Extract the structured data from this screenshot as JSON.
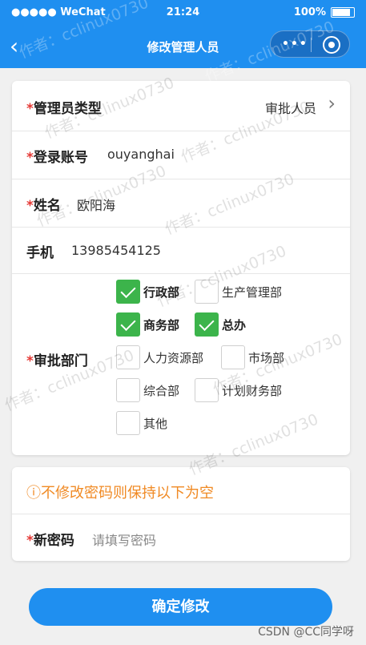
{
  "status_bar": {
    "carrier": "●●●●● WeChat",
    "time": "21:24",
    "battery": "100%"
  },
  "nav": {
    "back_icon": "chevron-left-icon",
    "title": "修改管理人员",
    "menu_icon": "more-dots-icon",
    "target_icon": "target-icon"
  },
  "form": {
    "admin_type": {
      "required": "*",
      "label": "管理员类型",
      "value": "审批人员"
    },
    "login": {
      "required": "*",
      "label": "登录账号",
      "value": "ouyanghai"
    },
    "name": {
      "required": "*",
      "label": "姓名",
      "value": "欧阳海"
    },
    "phone": {
      "label": "手机",
      "value": "13985454125"
    },
    "dept": {
      "required": "*",
      "label": "审批部门",
      "options": [
        {
          "label": "行政部",
          "checked": true
        },
        {
          "label": "生产管理部",
          "checked": false
        },
        {
          "label": "商务部",
          "checked": true
        },
        {
          "label": "总办",
          "checked": true
        },
        {
          "label": "人力资源部",
          "checked": false
        },
        {
          "label": "市场部",
          "checked": false
        },
        {
          "label": "综合部",
          "checked": false
        },
        {
          "label": "计划财务部",
          "checked": false
        },
        {
          "label": "其他",
          "checked": false
        }
      ]
    }
  },
  "password": {
    "notice": "ⓘ不修改密码则保持以下为空",
    "required": "*",
    "label": "新密码",
    "placeholder": "请填写密码"
  },
  "confirm_label": "确定修改",
  "watermark": "作者：cclinux0730",
  "credit": "CSDN @CC同学呀",
  "colors": {
    "accent": "#1f8ff0",
    "check": "#3cb44b",
    "required": "#e53935",
    "notice": "#f08a24"
  }
}
